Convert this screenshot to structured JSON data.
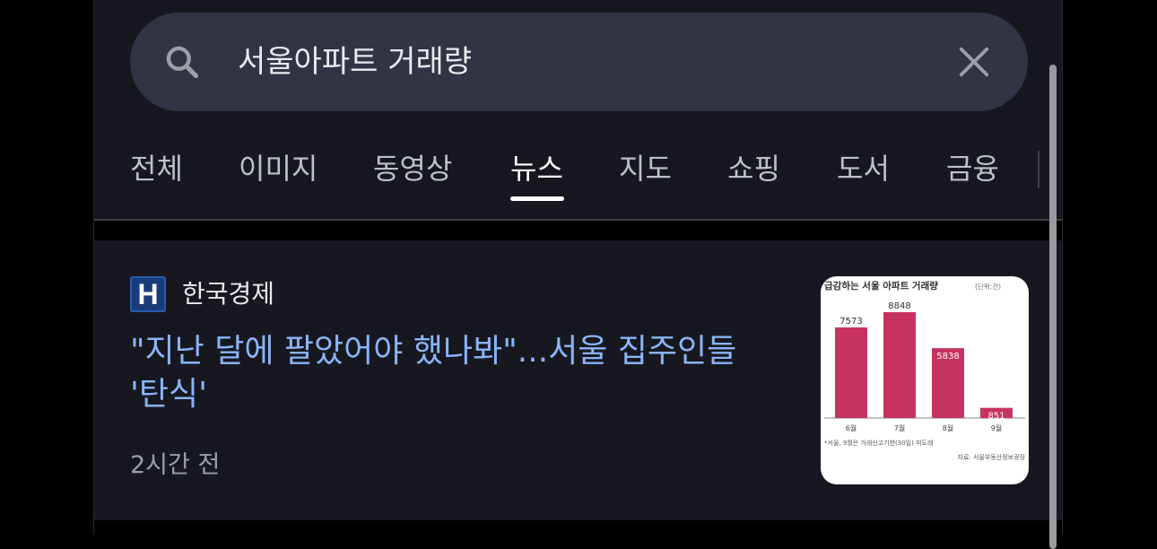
{
  "search": {
    "query": "서울아파트 거래량",
    "icon": "search-icon",
    "clear_icon": "close-icon"
  },
  "tabs": [
    {
      "label": "전체",
      "active": false
    },
    {
      "label": "이미지",
      "active": false
    },
    {
      "label": "동영상",
      "active": false
    },
    {
      "label": "뉴스",
      "active": true
    },
    {
      "label": "지도",
      "active": false
    },
    {
      "label": "쇼핑",
      "active": false
    },
    {
      "label": "도서",
      "active": false
    },
    {
      "label": "금융",
      "active": false
    }
  ],
  "result": {
    "source_logo_letter": "H",
    "source_name": "한국경제",
    "headline": "\"지난 달에 팔았어야 했나봐\"...서울 집주인들 '탄식'",
    "time": "2시간 전",
    "thumbnail": {
      "title": "급감하는 서울 아파트 거래량",
      "title_unit": "(단위:건)",
      "footnote": "*서울, 9월은 거래신고기한(30일) 미도래",
      "source": "자료: 서울부동산정보광장",
      "chart_data": {
        "type": "bar",
        "categories": [
          "6월",
          "7월",
          "8월",
          "9월"
        ],
        "values": [
          7573,
          8848,
          5838,
          851
        ],
        "color": "#c8325e"
      }
    }
  },
  "colors": {
    "background": "#000000",
    "panel": "#17181f",
    "search_bg": "#303443",
    "headline": "#8ab4f8",
    "secondary_text": "#9aa0a6"
  }
}
